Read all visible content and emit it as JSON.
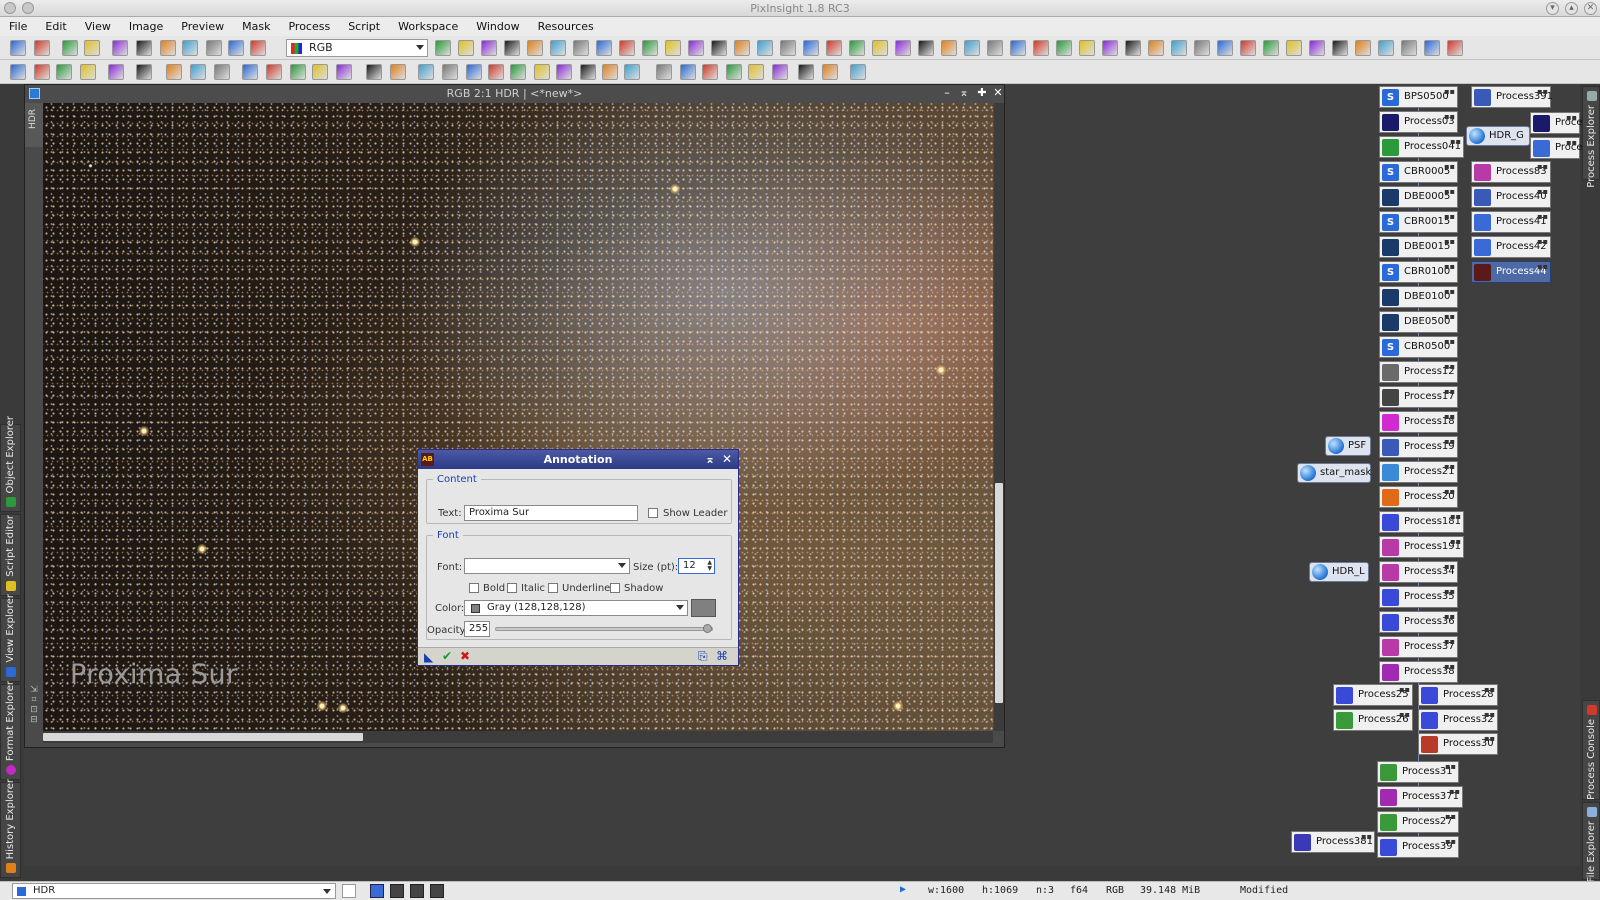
{
  "app": {
    "title": "PixInsight 1.8 RC3",
    "menu": [
      "File",
      "Edit",
      "View",
      "Image",
      "Preview",
      "Mask",
      "Process",
      "Script",
      "Workspace",
      "Window",
      "Resources"
    ],
    "rgb_select": "RGB"
  },
  "left_tabs": [
    "Object Explorer",
    "Script Editor",
    "View Explorer",
    "Format Explorer",
    "History Explorer"
  ],
  "right_tabs": [
    "Process Explorer",
    "Process Console",
    "File Explorer"
  ],
  "image_window": {
    "title": "RGB 2:1 HDR | <*new*>",
    "side_tab": "HDR",
    "annotation_text": "Proxima Sur"
  },
  "annotation_dialog": {
    "title": "Annotation",
    "icon": "AB",
    "content_legend": "Content",
    "text_label": "Text:",
    "text_value": "Proxima Sur",
    "show_leader_label": "Show Leader",
    "font_legend": "Font",
    "font_label": "Font:",
    "font_value": "",
    "size_label": "Size (pt):",
    "size_value": "12",
    "bold_label": "Bold",
    "italic_label": "Italic",
    "underline_label": "Underline",
    "shadow_label": "Shadow",
    "color_label": "Color:",
    "color_value": "Gray (128,128,128)",
    "color_swatch": "#808080",
    "opacity_label": "Opacity:",
    "opacity_value": "255",
    "opacity_fraction": 1.0
  },
  "status": {
    "view": "HDR",
    "width": "w:1600",
    "height": "h:1069",
    "channels": "n:3",
    "format": "f64",
    "colorspace": "RGB",
    "memory": "39.148 MiB",
    "state": "Modified"
  },
  "process_icons": {
    "col_main": [
      "BPS0500",
      "Process03",
      "Process041",
      "CBR0005",
      "DBE0005",
      "CBR0015",
      "DBE0015",
      "CBR0100",
      "DBE0100",
      "DBE0500",
      "CBR0500",
      "Process12",
      "Process17",
      "Process18",
      "Process19",
      "Process21",
      "Process20",
      "Process181",
      "Process191",
      "Process34",
      "Process35",
      "Process36",
      "Process37",
      "Process38"
    ],
    "col_right": [
      "Process391",
      "Process83",
      "Process40",
      "Process41",
      "Process42",
      "Process44"
    ],
    "far_right": [
      "Proce",
      "Proce"
    ],
    "col_low": [
      "Process25",
      "Process28",
      "Process26",
      "Process32",
      "Process30",
      "Process31",
      "Process371",
      "Process27",
      "Process39",
      "Process381"
    ],
    "image_icons": [
      "HDR_G",
      "PSF",
      "star_mask",
      "HDR_L"
    ],
    "colors": {
      "script": "#2a6ad8",
      "selected": "#4e6aa6"
    }
  }
}
